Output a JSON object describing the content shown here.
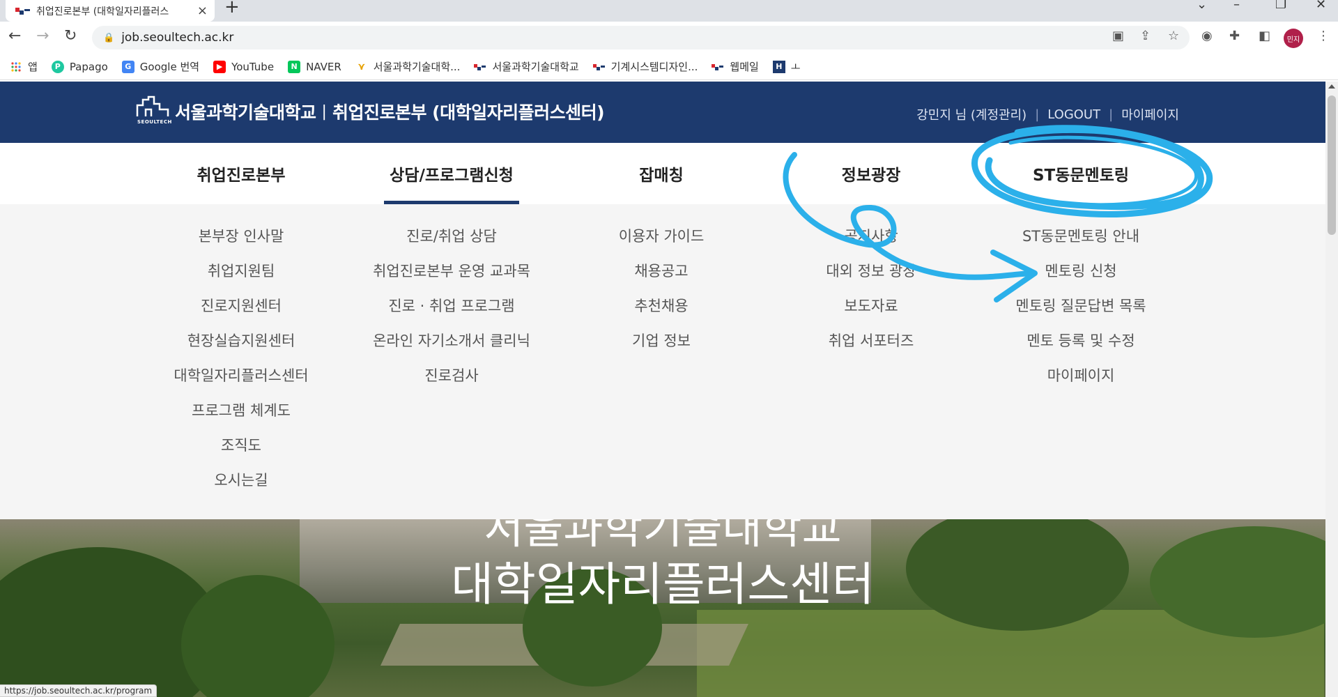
{
  "browser": {
    "tab_title": "취업진로본부 (대학일자리플러스",
    "tab_close": "×",
    "new_tab": "+",
    "url": "job.seoultech.ac.kr",
    "profile_initials": "민지",
    "status_url": "https://job.seoultech.ac.kr/program",
    "bookmarks": [
      {
        "label": "앱",
        "icon": "apps-grid-icon"
      },
      {
        "label": "Papago",
        "icon": "papago-icon"
      },
      {
        "label": "Google 번역",
        "icon": "google-translate-icon"
      },
      {
        "label": "YouTube",
        "icon": "youtube-icon"
      },
      {
        "label": "NAVER",
        "icon": "naver-icon"
      },
      {
        "label": "서울과학기술대학...",
        "icon": "seoultech-icon"
      },
      {
        "label": "서울과학기술대학교",
        "icon": "seoultech-icon"
      },
      {
        "label": "기계시스템디자인...",
        "icon": "seoultech-icon"
      },
      {
        "label": "웹메일",
        "icon": "seoultech-icon"
      },
      {
        "label": "ㅗ",
        "icon": "h-icon"
      }
    ]
  },
  "header": {
    "logo_name": "서울과학기술대학교",
    "logo_sub": "SEOULTECH",
    "separator": "|",
    "center_name": "취업진로본부 (대학일자리플러스센터)",
    "user_label": "강민지 님 (계정관리)",
    "logout": "LOGOUT",
    "mypage": "마이페이지",
    "divider": "|"
  },
  "gnb": {
    "items": [
      {
        "label": "취업진로본부"
      },
      {
        "label": "상담/프로그램신청"
      },
      {
        "label": "잡매칭"
      },
      {
        "label": "정보광장"
      },
      {
        "label": "ST동문멘토링"
      }
    ]
  },
  "submenu": {
    "col1": [
      "본부장 인사말",
      "취업지원팀",
      "진로지원센터",
      "현장실습지원센터",
      "대학일자리플러스센터",
      "프로그램 체계도",
      "조직도",
      "오시는길"
    ],
    "col2": [
      "진로/취업 상담",
      "취업진로본부 운영 교과목",
      "진로 · 취업 프로그램",
      "온라인 자기소개서 클리닉",
      "진로검사"
    ],
    "col3": [
      "이용자 가이드",
      "채용공고",
      "추천채용",
      "기업 정보"
    ],
    "col4": [
      "공지사항",
      "대외 정보 광장",
      "보도자료",
      "취업 서포터즈"
    ],
    "col5": [
      "ST동문멘토링 안내",
      "멘토링 신청",
      "멘토링 질문답변 목록",
      "멘토 등록 및 수정",
      "마이페이지"
    ]
  },
  "hero": {
    "title_line1": "서울과학기술대학교",
    "title_line2": "대학일자리플러스센터"
  },
  "colors": {
    "header_bg": "#1d3a6e",
    "annotation": "#2bb0ea"
  }
}
